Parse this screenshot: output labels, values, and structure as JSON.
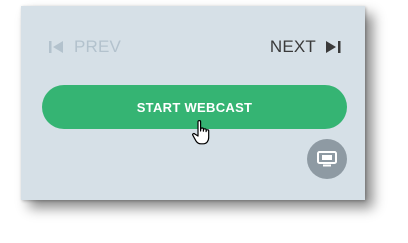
{
  "navigation": {
    "prev_label": "PREV",
    "next_label": "NEXT",
    "prev_icon": "skip-previous-icon",
    "next_icon": "skip-next-icon"
  },
  "webcast": {
    "start_label": "START WEBCAST"
  },
  "screen_button": {
    "icon": "screen-share-icon"
  },
  "cursor": {
    "icon": "hand-pointer-icon"
  },
  "colors": {
    "panel_bg": "#d6e0e7",
    "accent_green": "#35b473",
    "disabled_nav": "#b3c2cd",
    "nav_text": "#3a3a3a",
    "circle_button": "#8e9aa3"
  }
}
